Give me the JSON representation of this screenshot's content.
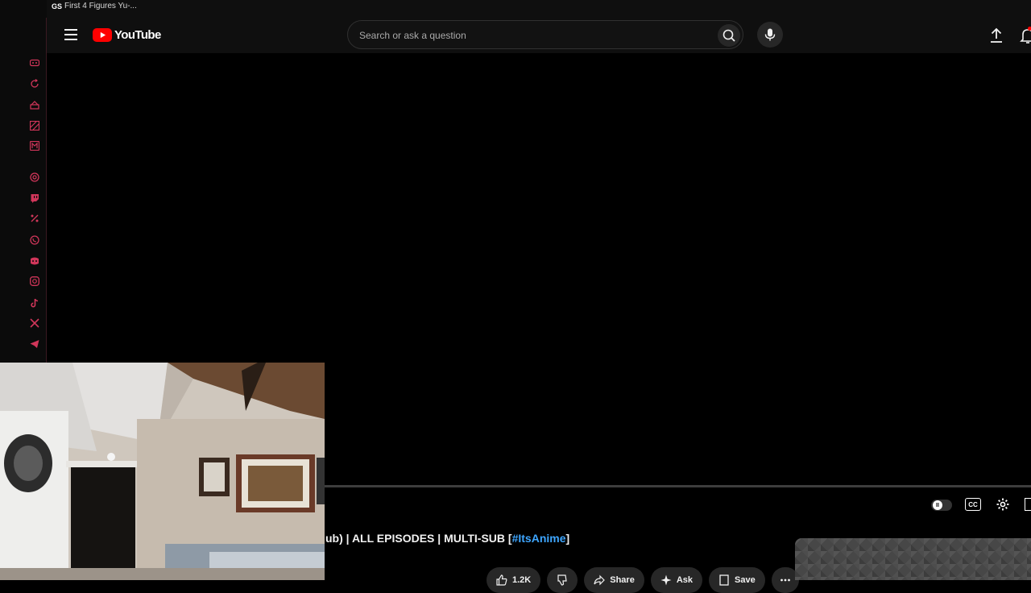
{
  "browser_tab": {
    "favicon_text": "GS",
    "title": "First 4 Figures Yu-..."
  },
  "left_rail": {
    "icons": [
      "gamepad-icon",
      "refresh-icon",
      "cake-icon",
      "stripes-icon",
      "m-icon",
      "openai-icon",
      "twitch-icon",
      "percent-icon",
      "whatsapp-icon",
      "discord-icon",
      "instagram-icon",
      "tiktok-icon",
      "x-icon",
      "telegram-icon"
    ],
    "accent_color": "#d1365a"
  },
  "header": {
    "logo_text": "YouTube",
    "search_placeholder": "Search or ask a question"
  },
  "video": {
    "title_main": "ub) | ALL EPISODES | MULTI-SUB [",
    "title_hashtag": "#ItsAnime",
    "title_end": "]"
  },
  "actions": {
    "like_count": "1.2K",
    "share_label": "Share",
    "ask_label": "Ask",
    "save_label": "Save"
  },
  "player_controls": {
    "cc_label": "CC",
    "autoplay_state": "paused"
  },
  "colors": {
    "brand": "#ff0000",
    "link": "#3ea6ff",
    "background": "#0f0f0f"
  }
}
